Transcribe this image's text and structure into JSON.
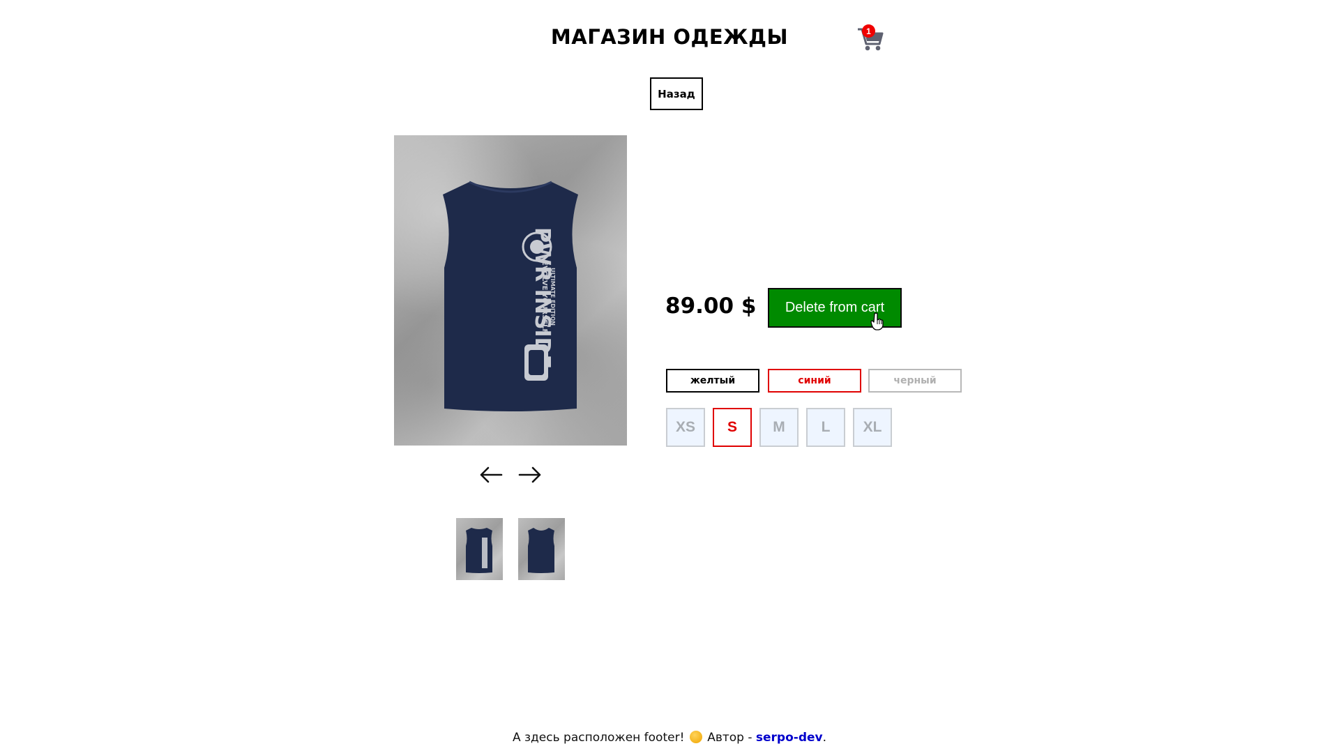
{
  "header": {
    "title": "МАГАЗИН ОДЕЖДЫ",
    "cart_count": "1"
  },
  "back_button": {
    "label": "Назад"
  },
  "product": {
    "price": "89.00 $",
    "cart_button_label": "Delete from cart",
    "colors": [
      {
        "label": "желтый",
        "state": "default",
        "border": "#000000",
        "text": "#000000"
      },
      {
        "label": "синий",
        "state": "selected",
        "border": "#e00000",
        "text": "#e00000"
      },
      {
        "label": "черный",
        "state": "unavailable",
        "border": "#b8b8b8",
        "text": "#b0b0b0"
      }
    ],
    "sizes": [
      {
        "label": "XS",
        "state": "unavailable"
      },
      {
        "label": "S",
        "state": "selected"
      },
      {
        "label": "M",
        "state": "unavailable"
      },
      {
        "label": "L",
        "state": "unavailable"
      },
      {
        "label": "XL",
        "state": "unavailable"
      }
    ],
    "image_text": {
      "line1": "PWR INSIDE",
      "line2": "EVOLVE YOURSELF",
      "line3": "ULTIMATE EDITION"
    }
  },
  "icons": {
    "cart": "cart-icon",
    "prev": "arrow-left-icon",
    "next": "arrow-right-icon",
    "emoji": "smiling-face-icon",
    "cursor": "hand-pointer-icon"
  },
  "colors": {
    "cart_button_bg": "#008a00",
    "badge": "#f00000",
    "selected": "#e00000",
    "shirt": "#1e2a4a",
    "link": "#0000cc"
  },
  "footer": {
    "text": "А здесь расположен footer!",
    "author_label": "Автор -",
    "author_link": "serpo-dev",
    "end": "."
  }
}
